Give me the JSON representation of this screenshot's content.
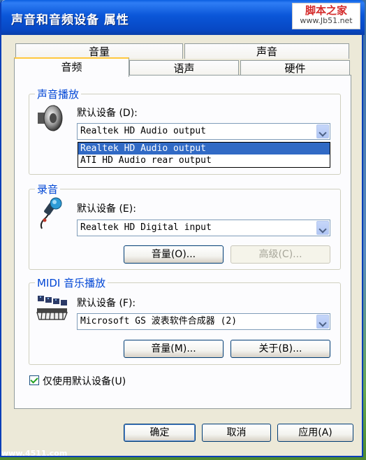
{
  "window": {
    "title": "声音和音频设备 属性"
  },
  "watermark": {
    "line1": "脚本之家",
    "line2": "www.Jb51.net"
  },
  "tabs": {
    "row1": [
      {
        "label": "音量"
      },
      {
        "label": "声音"
      }
    ],
    "row2": [
      {
        "label": "音频",
        "active": true
      },
      {
        "label": "语声"
      },
      {
        "label": "硬件"
      }
    ]
  },
  "playback": {
    "group_label": "声音播放",
    "default_device_label": "默认设备",
    "default_device_key": "(D):",
    "selected": "Realtek HD Audio output",
    "options": [
      "Realtek HD Audio output",
      "ATI HD Audio rear output"
    ]
  },
  "recording": {
    "group_label": "录音",
    "default_device_label": "默认设备",
    "default_device_key": "(E):",
    "selected": "Realtek HD Digital input",
    "volume_button": "音量(O)...",
    "advanced_button": "高级(C)..."
  },
  "midi": {
    "group_label": "MIDI 音乐播放",
    "default_device_label": "默认设备",
    "default_device_key": "(F):",
    "selected": "Microsoft GS 波表软件合成器 (2)",
    "volume_button": "音量(M)...",
    "about_button": "关于(B)..."
  },
  "only_default": {
    "label": "仅使用默认设备(U)",
    "checked": true
  },
  "footer": {
    "ok": "确定",
    "cancel": "取消",
    "apply": "应用(A)"
  },
  "bottom_watermark": "www.4511.com",
  "colors": {
    "title_bar": "#0a56d8",
    "group_label": "#0046d5",
    "selection": "#316ac5"
  }
}
